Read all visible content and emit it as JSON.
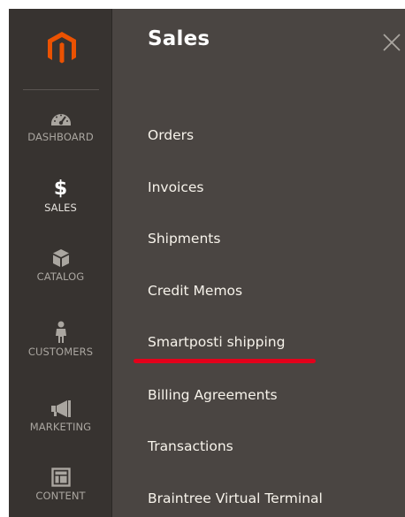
{
  "rail": {
    "items": [
      {
        "label": "DASHBOARD",
        "icon": "speedometer-icon"
      },
      {
        "label": "SALES",
        "icon": "dollar-icon",
        "glyph": "$"
      },
      {
        "label": "CATALOG",
        "icon": "box-icon"
      },
      {
        "label": "CUSTOMERS",
        "icon": "person-icon"
      },
      {
        "label": "MARKETING",
        "icon": "megaphone-icon"
      },
      {
        "label": "CONTENT",
        "icon": "layout-icon"
      }
    ],
    "active": "SALES"
  },
  "flyout": {
    "title": "Sales",
    "items": [
      {
        "label": "Orders"
      },
      {
        "label": "Invoices"
      },
      {
        "label": "Shipments"
      },
      {
        "label": "Credit Memos"
      },
      {
        "label": "Smartposti shipping"
      },
      {
        "label": "Billing Agreements"
      },
      {
        "label": "Transactions"
      },
      {
        "label": "Braintree Virtual Terminal"
      }
    ],
    "highlighted": "Smartposti shipping"
  },
  "colors": {
    "rail_bg": "#373330",
    "flyout_bg": "#4a4542",
    "logo_orange": "#eb5202",
    "highlight_red": "#e3001b",
    "menu_text": "#f7f3eb",
    "rail_text": "#aaa6a0"
  }
}
